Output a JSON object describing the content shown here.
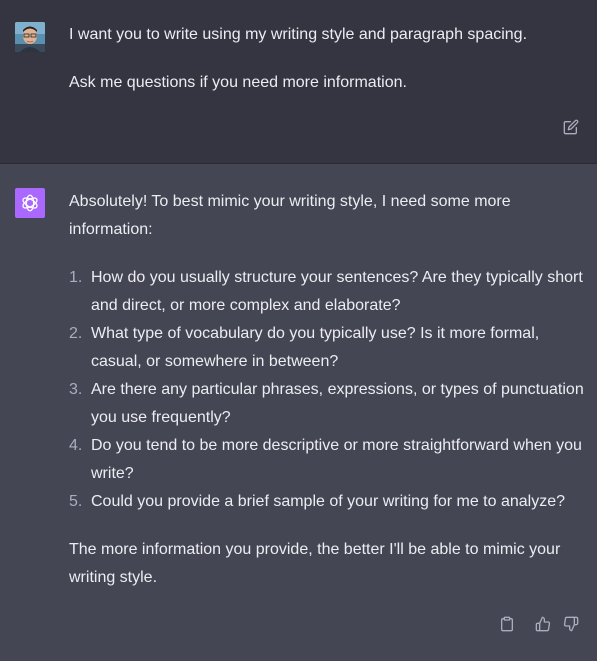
{
  "user_message": {
    "paragraphs": [
      "I want you to write using my writing style and paragraph spacing.",
      "Ask me questions if you need more information."
    ],
    "avatar_icon": "user-avatar-photo",
    "edit_icon": "edit-icon"
  },
  "assistant_message": {
    "intro": "Absolutely! To best mimic your writing style, I need some more information:",
    "questions": [
      {
        "number": "1.",
        "text": "How do you usually structure your sentences? Are they typically short and direct, or more complex and elaborate?"
      },
      {
        "number": "2.",
        "text": "What type of vocabulary do you typically use? Is it more formal, casual, or somewhere in between?"
      },
      {
        "number": "3.",
        "text": "Are there any particular phrases, expressions, or types of punctuation you use frequently?"
      },
      {
        "number": "4.",
        "text": "Do you tend to be more descriptive or more straightforward when you write?"
      },
      {
        "number": "5.",
        "text": "Could you provide a brief sample of your writing for me to analyze?"
      }
    ],
    "outro": "The more information you provide, the better I'll be able to mimic your writing style.",
    "avatar_icon": "openai-logo-icon",
    "accent_color": "#ab68ff"
  },
  "colors": {
    "user_bg": "#343541",
    "assistant_bg": "#444654",
    "text": "#ececf1",
    "muted": "#acacbe"
  }
}
